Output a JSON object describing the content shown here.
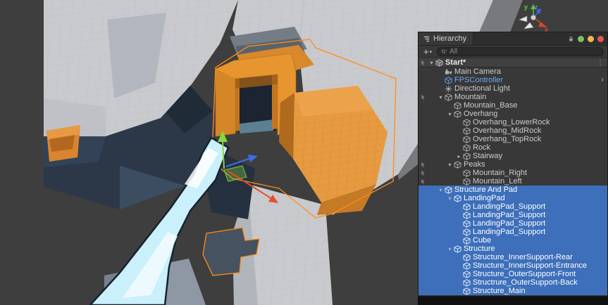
{
  "scene": {
    "axis_labels": {
      "y": "y",
      "z": "z",
      "x": "x"
    },
    "colors": {
      "background": "#3E3E3E",
      "selection_outline": "#FF8C1A",
      "water": "#C9F0FB",
      "gizmo_y_green": "#84D93E",
      "gizmo_z_blue": "#3D6DEB",
      "gizmo_x_red": "#E44E2E"
    }
  },
  "panel": {
    "tab_title": "Hierarchy",
    "create_button_label": "+",
    "search_placeholder": "All",
    "window_dots": [
      "#77C45E",
      "#EDBB4C",
      "#E2574C"
    ],
    "rows": [
      {
        "label": "Start*",
        "depth": 0,
        "icon": "scene",
        "arrow": "down",
        "kind": "scene-header",
        "gutter": true,
        "trailing": "menu"
      },
      {
        "label": "Main Camera",
        "depth": 1,
        "icon": "camera"
      },
      {
        "label": "FPSController",
        "depth": 1,
        "icon": "cube",
        "blue": true,
        "trailing": "chevron"
      },
      {
        "label": "Directional Light",
        "depth": 1,
        "icon": "light"
      },
      {
        "label": "Mountain",
        "depth": 1,
        "icon": "cube",
        "arrow": "down",
        "gutter": true
      },
      {
        "label": "Mountain_Base",
        "depth": 2,
        "icon": "cube"
      },
      {
        "label": "Overhang",
        "depth": 2,
        "icon": "cube",
        "arrow": "down"
      },
      {
        "label": "Overhang_LowerRock",
        "depth": 3,
        "icon": "cube"
      },
      {
        "label": "Overhang_MidRock",
        "depth": 3,
        "icon": "cube"
      },
      {
        "label": "Overhang_TopRock",
        "depth": 3,
        "icon": "cube"
      },
      {
        "label": "Rock",
        "depth": 3,
        "icon": "cube"
      },
      {
        "label": "Stairway",
        "depth": 3,
        "icon": "cube",
        "arrow": "right"
      },
      {
        "label": "Peaks",
        "depth": 2,
        "icon": "cube",
        "arrow": "down",
        "gutter": true
      },
      {
        "label": "Mountain_Right",
        "depth": 3,
        "icon": "cube",
        "gutter": true
      },
      {
        "label": "Mountain_Left",
        "depth": 3,
        "icon": "cube",
        "gutter": true
      },
      {
        "label": "Structure And Pad",
        "depth": 1,
        "icon": "cube",
        "arrow": "down",
        "selected": true
      },
      {
        "label": "LandingPad",
        "depth": 2,
        "icon": "cube",
        "arrow": "down",
        "selected": true
      },
      {
        "label": "LandingPad_Support",
        "depth": 3,
        "icon": "cube",
        "selected": true
      },
      {
        "label": "LandingPad_Support",
        "depth": 3,
        "icon": "cube",
        "selected": true
      },
      {
        "label": "LandingPad_Support",
        "depth": 3,
        "icon": "cube",
        "selected": true
      },
      {
        "label": "LandingPad_Support",
        "depth": 3,
        "icon": "cube",
        "selected": true
      },
      {
        "label": "Cube",
        "depth": 3,
        "icon": "cube",
        "selected": true
      },
      {
        "label": "Structure",
        "depth": 2,
        "icon": "cube",
        "arrow": "down",
        "selected": true
      },
      {
        "label": "Structure_InnerSupport-Rear",
        "depth": 3,
        "icon": "cube",
        "selected": true
      },
      {
        "label": "Structure_InnerSupport-Entrance",
        "depth": 3,
        "icon": "cube",
        "selected": true
      },
      {
        "label": "Structure_OuterSupport-Front",
        "depth": 3,
        "icon": "cube",
        "selected": true
      },
      {
        "label": "Structrure_OuterSupport-Back",
        "depth": 3,
        "icon": "cube",
        "selected": true
      },
      {
        "label": "Structure_Main",
        "depth": 3,
        "icon": "cube",
        "selected": true
      }
    ]
  }
}
